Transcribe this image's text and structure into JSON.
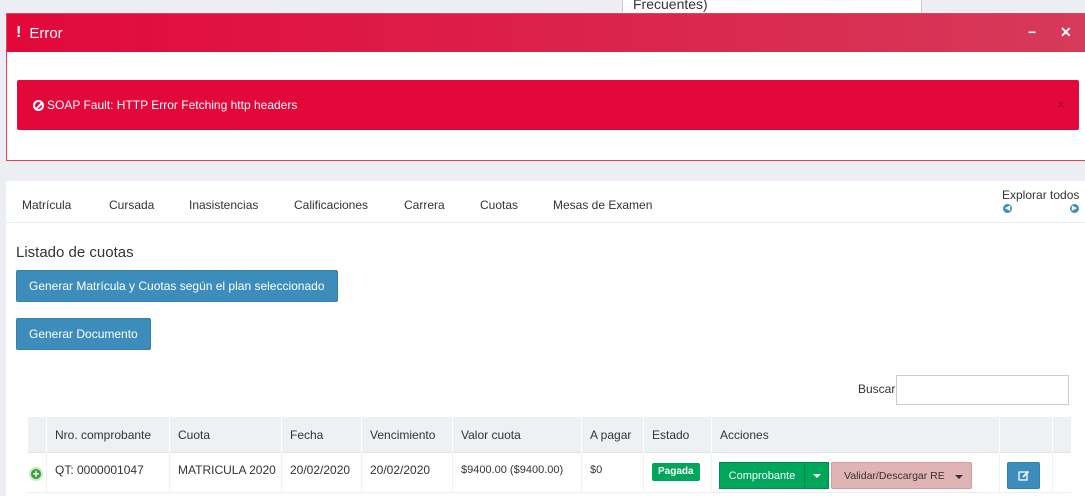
{
  "tooltip": {
    "text": "Frecuentes)"
  },
  "error_panel": {
    "title": "Error",
    "minimize_glyph": "−",
    "close_glyph": "✕",
    "alert_text": "SOAP Fault: HTTP Error Fetching http headers",
    "alert_dismiss": "×"
  },
  "tabs": [
    "Matrícula",
    "Cursada",
    "Inasistencias",
    "Calificaciones",
    "Carrera",
    "Cuotas",
    "Mesas de Examen"
  ],
  "explore": {
    "label": "Explorar todos"
  },
  "section": {
    "title": "Listado de cuotas",
    "generate_button": "Generar Matrícula y Cuotas según el plan seleccionado",
    "document_button": "Generar Documento"
  },
  "search": {
    "label": "Buscar:",
    "value": ""
  },
  "table": {
    "headers": [
      "Nro. comprobante",
      "Cuota",
      "Fecha",
      "Vencimiento",
      "Valor cuota",
      "A pagar",
      "Estado",
      "Acciones"
    ],
    "rows": [
      {
        "nro": "QT: 0000001047",
        "cuota": "MATRICULA 2020",
        "fecha": "20/02/2020",
        "vencimiento": "20/02/2020",
        "valor": "$9400.00 ($9400.00)",
        "a_pagar": "$0",
        "estado": "Pagada",
        "accion_comprobante": "Comprobante",
        "accion_validar": "Validar/Descargar RE"
      }
    ]
  },
  "colors": {
    "error_red": "#e2083a",
    "primary_blue": "#3c8dbc",
    "success_green": "#00a65a",
    "pink_button": "#e0b4b4"
  }
}
